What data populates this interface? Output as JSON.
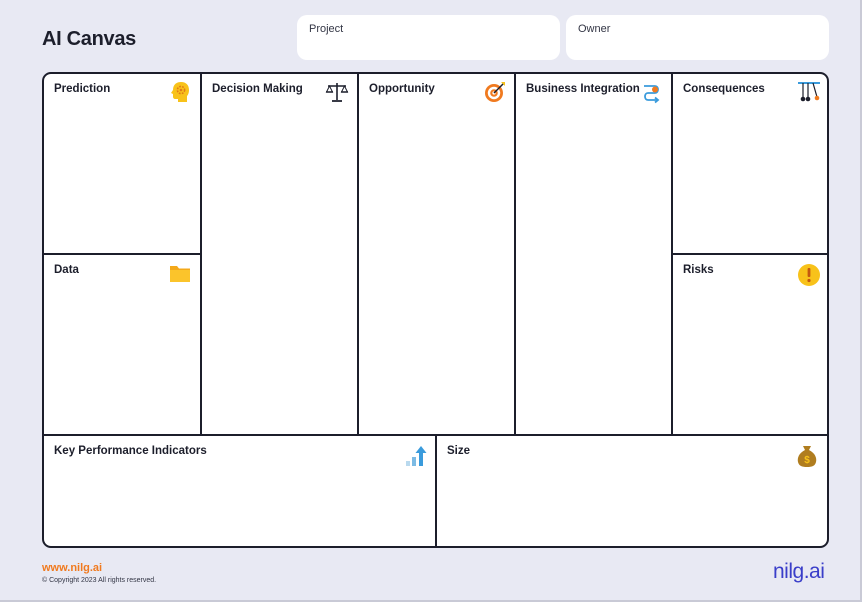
{
  "header": {
    "title": "AI Canvas",
    "project_label": "Project",
    "owner_label": "Owner"
  },
  "blocks": {
    "prediction": {
      "title": "Prediction",
      "icon": "head-gear-icon"
    },
    "decision_making": {
      "title": "Decision Making",
      "icon": "scales-icon"
    },
    "opportunity": {
      "title": "Opportunity",
      "icon": "target-icon"
    },
    "business_integration": {
      "title": "Business Integration",
      "icon": "integration-arrow-icon"
    },
    "consequences": {
      "title": "Consequences",
      "icon": "pendulum-icon"
    },
    "data": {
      "title": "Data",
      "icon": "folder-icon"
    },
    "risks": {
      "title": "Risks",
      "icon": "warning-icon"
    },
    "kpi": {
      "title": "Key Performance Indicators",
      "icon": "growth-chart-icon"
    },
    "size": {
      "title": "Size",
      "icon": "money-bag-icon"
    }
  },
  "footer": {
    "url": "www.nilg.ai",
    "copyright": "© Copyright 2023 All rights reserved.",
    "logo": "nilg.ai"
  },
  "colors": {
    "background": "#e8e9f3",
    "border": "#1c1e2b",
    "accent_orange": "#f07a1f",
    "accent_yellow": "#f8c21a",
    "accent_blue": "#3a9bdc",
    "logo_blue": "#3a3ec9"
  }
}
